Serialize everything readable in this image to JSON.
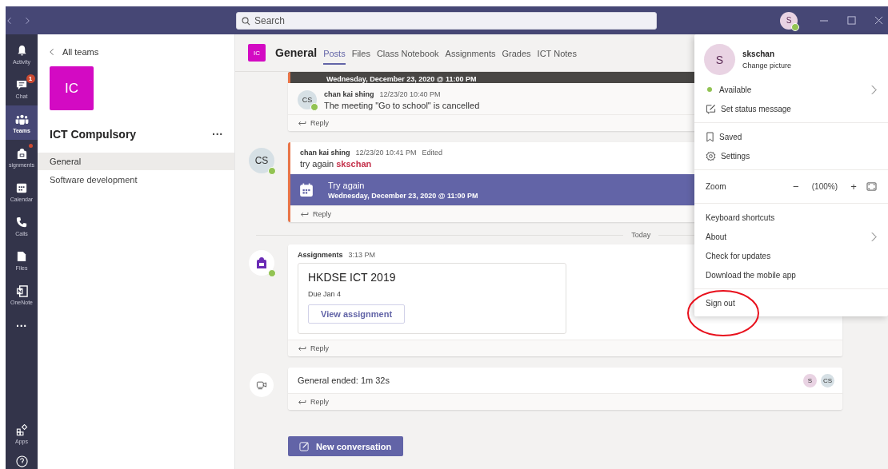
{
  "titlebar": {
    "search": {
      "placeholder": "Search"
    },
    "avatar": "S",
    "presence": {
      "color": "#92c353"
    }
  },
  "rail": {
    "items": [
      {
        "label": "Activity",
        "kind": "bell",
        "selected": false,
        "dot": false
      },
      {
        "label": "Chat",
        "kind": "chat",
        "selected": false,
        "badge": "1",
        "dot": false
      },
      {
        "label": "Teams",
        "kind": "teams",
        "selected": true,
        "dot": false
      },
      {
        "label": "signments",
        "kind": "bag",
        "selected": false,
        "dot": true
      },
      {
        "label": "Calendar",
        "kind": "calendar",
        "selected": false,
        "dot": false
      },
      {
        "label": "Calls",
        "kind": "phone",
        "selected": false,
        "dot": false
      },
      {
        "label": "Files",
        "kind": "file",
        "selected": false,
        "dot": false
      },
      {
        "label": "OneNote",
        "kind": "note",
        "selected": false,
        "dot": false
      }
    ],
    "more": "···",
    "bottom": [
      {
        "label": "Apps",
        "kind": "apps"
      }
    ]
  },
  "team_panel": {
    "back": "All teams",
    "tile": "IC",
    "name": "ICT Compulsory",
    "more": "···",
    "channels": [
      {
        "label": "General",
        "selected": true
      },
      {
        "label": "Software development",
        "selected": false
      }
    ]
  },
  "header": {
    "tile": "IC",
    "channel": "General",
    "tabs": [
      {
        "label": "Posts",
        "selected": true
      },
      {
        "label": "Files",
        "selected": false
      },
      {
        "label": "Class Notebook",
        "selected": false
      },
      {
        "label": "Assignments",
        "selected": false
      },
      {
        "label": "Grades",
        "selected": false
      },
      {
        "label": "ICT Notes",
        "selected": false
      }
    ]
  },
  "posts": [
    {
      "kind": "meeting_reply",
      "banner_date": "Wednesday, December 23, 2020 @ 11:00 PM",
      "reply": {
        "avatar": "CS",
        "author": "chan kai shing",
        "time": "12/23/20 10:40 PM",
        "text": "The meeting \"Go to school\" is cancelled"
      },
      "reply_label": "Reply"
    },
    {
      "kind": "meeting",
      "avatar": "CS",
      "author": "chan kai shing",
      "time": "12/23/20 10:41 PM",
      "edited": "Edited",
      "text": "try again **skschan**",
      "meeting_title": "Try again",
      "meeting_date": "Wednesday, December 23, 2020 @ 11:00 PM",
      "reply_label": "Reply"
    },
    {
      "kind": "divider",
      "label": "Today"
    },
    {
      "kind": "assignment",
      "author": "Assignments",
      "time": "3:13 PM",
      "title": "HKDSE ICT 2019",
      "due": "Due Jan 4",
      "button": "View assignment",
      "reply_label": "Reply"
    },
    {
      "kind": "call",
      "text": "General ended: 1m 32s",
      "participants": [
        "S",
        "CS"
      ],
      "reply_label": "Reply"
    }
  ],
  "new_conversation": "New conversation",
  "profile_menu": {
    "avatar": "S",
    "name": "skschan",
    "change_picture": "Change picture",
    "sections": [
      [
        {
          "kind": "status",
          "label": "Available",
          "has_submenu": true
        },
        {
          "kind": "status_message",
          "label": "Set status message",
          "has_submenu": false
        }
      ],
      [
        {
          "kind": "saved",
          "label": "Saved",
          "has_submenu": false
        },
        {
          "kind": "settings",
          "label": "Settings",
          "has_submenu": false
        }
      ],
      [
        {
          "kind": "zoom",
          "label": "Zoom",
          "value": "(100%)",
          "minus": "−",
          "plus": "+"
        }
      ],
      [
        {
          "kind": "plain",
          "label": "Keyboard shortcuts",
          "has_submenu": false
        },
        {
          "kind": "plain",
          "label": "About",
          "has_submenu": true
        },
        {
          "kind": "plain",
          "label": "Check for updates",
          "has_submenu": false
        },
        {
          "kind": "plain",
          "label": "Download the mobile app",
          "has_submenu": false
        }
      ],
      [
        {
          "kind": "plain",
          "label": "Sign out",
          "has_submenu": false,
          "circled": true
        }
      ]
    ]
  }
}
